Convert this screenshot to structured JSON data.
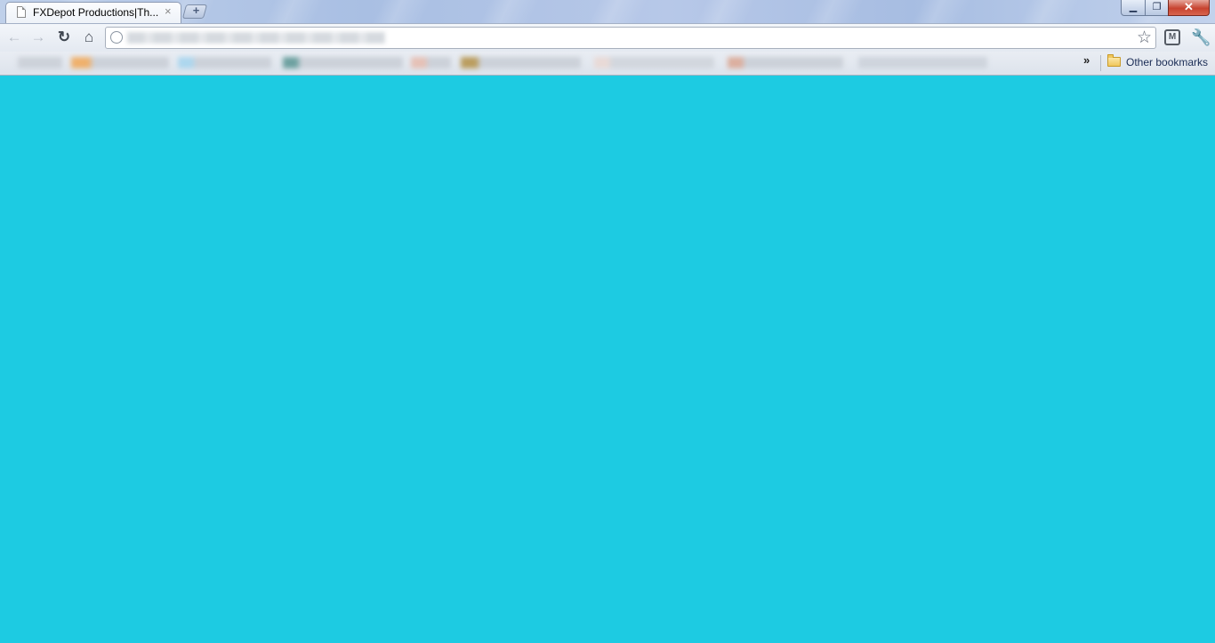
{
  "tab": {
    "title": "FXDepot Productions|Th...",
    "close_glyph": "×",
    "icon": "page-icon"
  },
  "new_tab": {
    "glyph": "+",
    "icon": "new-tab-icon"
  },
  "window_controls": {
    "minimize": "▁",
    "maximize": "❐",
    "close": "✕"
  },
  "toolbar": {
    "back": "←",
    "forward": "→",
    "reload": "↻",
    "home": "⌂",
    "star": "☆",
    "extension": "M",
    "wrench": "🔧"
  },
  "omnibox": {
    "icon": "globe-icon"
  },
  "bookmarks_bar": {
    "chevron": "»",
    "other_bookmarks": "Other bookmarks",
    "folder_icon": "folder-icon"
  },
  "colors": {
    "page_background": "#1dcbe2"
  }
}
